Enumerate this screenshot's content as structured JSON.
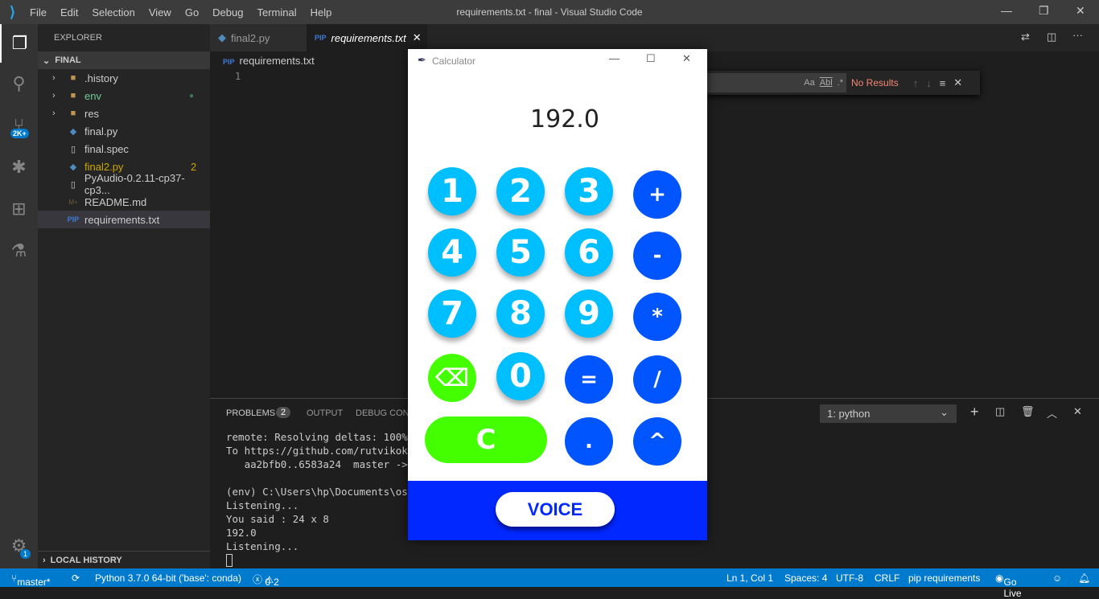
{
  "window": {
    "title": "requirements.txt - final - Visual Studio Code",
    "menu": [
      "File",
      "Edit",
      "Selection",
      "View",
      "Go",
      "Debug",
      "Terminal",
      "Help"
    ]
  },
  "activity": {
    "scm_badge": "2K+",
    "settings_badge": "1"
  },
  "sidebar": {
    "header": "EXPLORER",
    "folder": "FINAL",
    "items": [
      {
        "label": ".history",
        "type": "folder"
      },
      {
        "label": "env",
        "type": "folder",
        "color": "#73c991"
      },
      {
        "label": "res",
        "type": "folder"
      },
      {
        "label": "final.py",
        "type": "python"
      },
      {
        "label": "final.spec",
        "type": "file"
      },
      {
        "label": "final2.py",
        "type": "python",
        "color": "#cca700",
        "badge": "2"
      },
      {
        "label": "PyAudio-0.2.11-cp37-cp3...",
        "type": "file"
      },
      {
        "label": "README.md",
        "type": "markdown"
      },
      {
        "label": "requirements.txt",
        "type": "pip",
        "selected": true
      }
    ],
    "local_history": "LOCAL HISTORY"
  },
  "tabs": [
    {
      "label": "final2.py"
    },
    {
      "label": "requirements.txt",
      "active": true
    }
  ],
  "editor": {
    "breadcrumb": "requirements.txt",
    "line_number": "1"
  },
  "find": {
    "no_results": "No Results",
    "aa": "Aa",
    "abl": "Abl",
    "regex": ".*"
  },
  "panel": {
    "tabs": [
      "PROBLEMS",
      "OUTPUT",
      "DEBUG CONS"
    ],
    "problems_count": "2",
    "terminal_select": "1: python",
    "lines": [
      "remote: Resolving deltas: 100% (1",
      "To https://github.com/rutvikokate",
      "   aa2bfb0..6583a24  master -> ma",
      "",
      "(env) C:\\Users\\hp\\Documents\\ostl\\",
      "Listening...",
      "You said : 24 x 8",
      "192.0",
      "Listening..."
    ]
  },
  "status": {
    "branch": "master*",
    "python": "Python 3.7.0 64-bit ('base': conda)",
    "errors": "0",
    "warnings": "2",
    "position": "Ln 1, Col 1",
    "spaces": "Spaces: 4",
    "encoding": "UTF-8",
    "eol": "CRLF",
    "language": "pip requirements",
    "golive": "Go Live"
  },
  "calculator": {
    "title": "Calculator",
    "display": "192.0",
    "buttons": [
      [
        "1",
        "2",
        "3",
        "+"
      ],
      [
        "4",
        "5",
        "6",
        "-"
      ],
      [
        "7",
        "8",
        "9",
        "*"
      ],
      [
        "backspace",
        "0",
        "=",
        "/"
      ],
      [
        "C",
        ".",
        "^"
      ]
    ],
    "voice": "VOICE",
    "colors": {
      "digit": "#00bfff",
      "operator": "#0055ff",
      "clear": "#44ff00",
      "footer": "#0028ff"
    }
  }
}
